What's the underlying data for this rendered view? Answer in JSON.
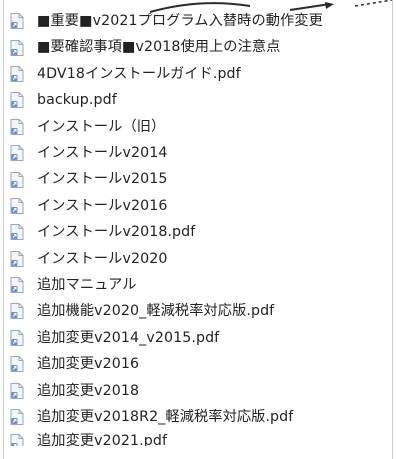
{
  "menu": {
    "items": [
      {
        "label": "■重要■v2021プログラム入替時の動作変更",
        "icon": "document-alias-icon"
      },
      {
        "label": "■要確認事項■v2018使用上の注意点",
        "icon": "document-alias-icon"
      },
      {
        "label": "4DV18インストールガイド.pdf",
        "icon": "document-alias-icon"
      },
      {
        "label": "backup.pdf",
        "icon": "document-alias-icon"
      },
      {
        "label": "インストール（旧）",
        "icon": "document-alias-icon"
      },
      {
        "label": "インストールv2014",
        "icon": "document-alias-icon"
      },
      {
        "label": "インストールv2015",
        "icon": "document-alias-icon"
      },
      {
        "label": "インストールv2016",
        "icon": "document-alias-icon"
      },
      {
        "label": "インストールv2018.pdf",
        "icon": "document-alias-icon"
      },
      {
        "label": "インストールv2020",
        "icon": "document-alias-icon"
      },
      {
        "label": "追加マニュアル",
        "icon": "document-alias-icon"
      },
      {
        "label": "追加機能v2020_軽減税率対応版.pdf",
        "icon": "document-alias-icon"
      },
      {
        "label": "追加変更v2014_v2015.pdf",
        "icon": "document-alias-icon"
      },
      {
        "label": "追加変更v2016",
        "icon": "document-alias-icon"
      },
      {
        "label": "追加変更v2018",
        "icon": "document-alias-icon"
      },
      {
        "label": "追加変更v2018R2_軽減税率対応版.pdf",
        "icon": "document-alias-icon"
      },
      {
        "label": "追加変更v2021.pdf",
        "icon": "document-alias-icon"
      }
    ]
  },
  "colors": {
    "icon_page": "#f4f6fa",
    "icon_border": "#9aa6b8",
    "icon_badge": "#6c8fc9",
    "text": "#222222",
    "frame_border": "#cfcfcf"
  }
}
